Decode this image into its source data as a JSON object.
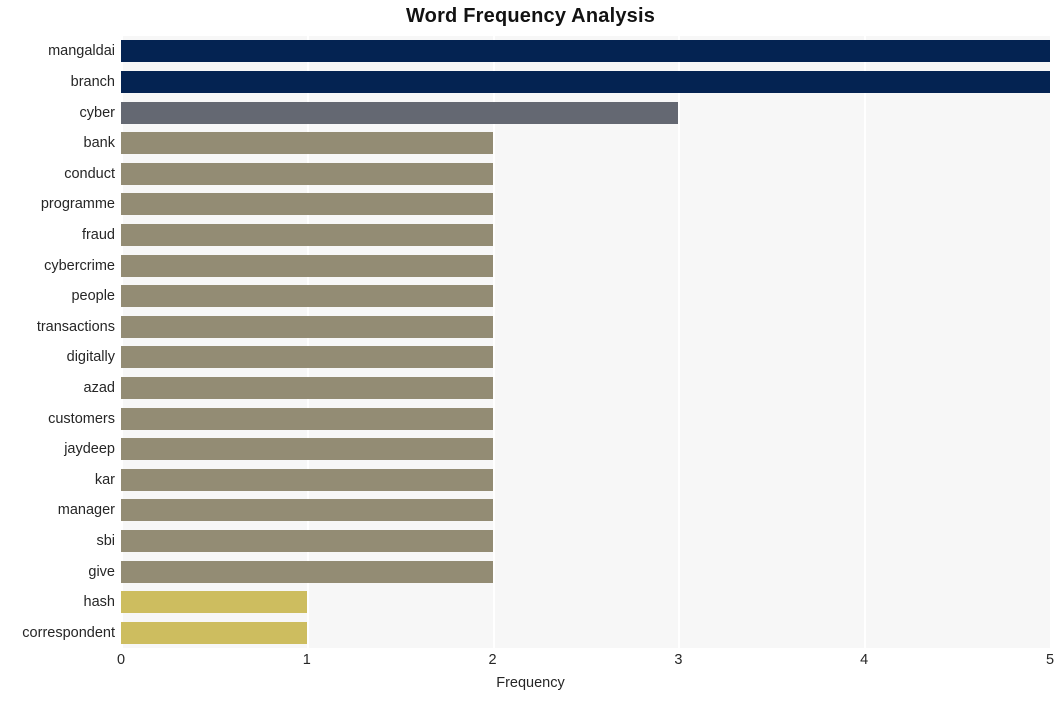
{
  "chart_data": {
    "type": "bar",
    "orientation": "horizontal",
    "title": "Word Frequency Analysis",
    "xlabel": "Frequency",
    "ylabel": "",
    "xlim": [
      0,
      5
    ],
    "xticks": [
      0,
      1,
      2,
      3,
      4,
      5
    ],
    "xticklabels": [
      "0",
      "1",
      "2",
      "3",
      "4",
      "5"
    ],
    "grid": true,
    "grid_axis": "x",
    "legend": false,
    "categories": [
      "mangaldai",
      "branch",
      "cyber",
      "bank",
      "conduct",
      "programme",
      "fraud",
      "cybercrime",
      "people",
      "transactions",
      "digitally",
      "azad",
      "customers",
      "jaydeep",
      "kar",
      "manager",
      "sbi",
      "give",
      "hash",
      "correspondent"
    ],
    "values": [
      5,
      5,
      3,
      2,
      2,
      2,
      2,
      2,
      2,
      2,
      2,
      2,
      2,
      2,
      2,
      2,
      2,
      2,
      1,
      1
    ],
    "bar_colors": [
      "#042352",
      "#042352",
      "#646872",
      "#938c74",
      "#938c74",
      "#938c74",
      "#938c74",
      "#938c74",
      "#938c74",
      "#938c74",
      "#938c74",
      "#938c74",
      "#938c74",
      "#938c74",
      "#938c74",
      "#938c74",
      "#938c74",
      "#938c74",
      "#cdbd5f",
      "#cdbd5f"
    ],
    "plot_background": "#f7f7f7",
    "gridline_color": "#ffffff",
    "figure_background": "#ffffff",
    "text_color": "#262626"
  }
}
